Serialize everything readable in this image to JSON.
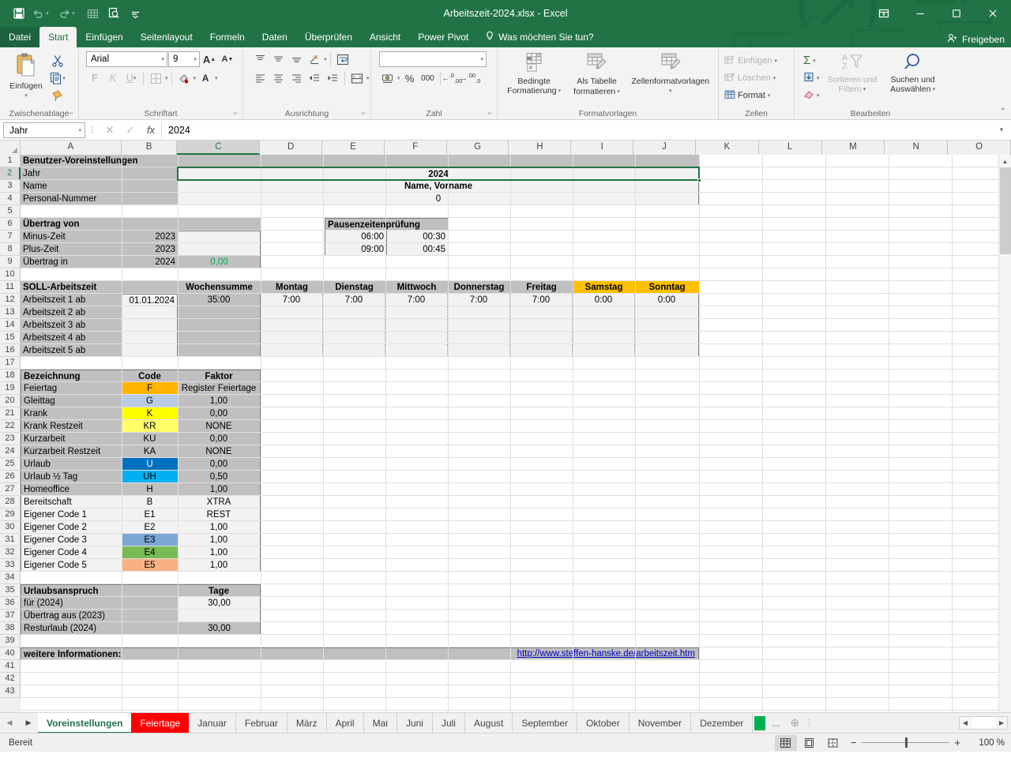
{
  "titlebar": {
    "title": "Arbeitszeit-2024.xlsx - Excel",
    "quick_access": [
      {
        "name": "save-icon",
        "label": "Speichern"
      },
      {
        "name": "undo-icon",
        "label": "Rückgängig"
      },
      {
        "name": "redo-icon",
        "label": "Wiederholen"
      },
      {
        "name": "table-icon",
        "label": "Tabelle"
      },
      {
        "name": "print-preview-icon",
        "label": "Seitenansicht"
      },
      {
        "name": "customize-qat-icon",
        "label": "Symbolleiste anpassen"
      }
    ],
    "window_buttons": {
      "ribbon_display": "Menüband-Anzeigeoptionen",
      "minimize": "Minimieren",
      "restore": "Wiederherstellen",
      "close": "Schließen"
    }
  },
  "ribbon": {
    "tabs": [
      {
        "label": "Datei",
        "active": false
      },
      {
        "label": "Start",
        "active": true
      },
      {
        "label": "Einfügen",
        "active": false
      },
      {
        "label": "Seitenlayout",
        "active": false
      },
      {
        "label": "Formeln",
        "active": false
      },
      {
        "label": "Daten",
        "active": false
      },
      {
        "label": "Überprüfen",
        "active": false
      },
      {
        "label": "Ansicht",
        "active": false
      },
      {
        "label": "Power Pivot",
        "active": false
      }
    ],
    "tellme": "Was möchten Sie tun?",
    "share": "Freigeben",
    "groups": {
      "clipboard": {
        "title": "Zwischenablage",
        "paste": "Einfügen",
        "cut": "Ausschneiden",
        "copy": "Kopieren",
        "format_painter": "Format übertragen"
      },
      "font": {
        "title": "Schriftart",
        "font_name": "Arial",
        "font_size": "9",
        "grow": "A",
        "shrink": "A",
        "bold": "F",
        "italic": "K",
        "underline": "U",
        "borders": "Rahmen",
        "fill": "Füllfarbe",
        "color": "A"
      },
      "alignment": {
        "title": "Ausrichtung",
        "wrap": "Zeilenumbruch",
        "merge": "Verbinden und zentrieren"
      },
      "number": {
        "title": "Zahl",
        "format_value": "",
        "currency": "Buchhaltungsformat",
        "percent": "%",
        "thousands": "000",
        "inc_dec": "Dezimalstelle hinzufügen",
        "dec_dec": "Dezimalstelle löschen"
      },
      "styles": {
        "title": "Formatvorlagen",
        "conditional": "Bedingte\nFormatierung",
        "conditional_l1": "Bedingte",
        "conditional_l2": "Formatierung",
        "as_table_l1": "Als Tabelle",
        "as_table_l2": "formatieren",
        "cell_styles": "Zellenformatvorlagen"
      },
      "cells": {
        "title": "Zellen",
        "insert": "Einfügen",
        "delete": "Löschen",
        "format": "Format"
      },
      "editing": {
        "title": "Bearbeiten",
        "autosum": "AutoSumme",
        "fill": "Füllbereich",
        "clear": "Löschen",
        "sort_l1": "Sortieren und",
        "sort_l2": "Filtern",
        "find_l1": "Suchen und",
        "find_l2": "Auswählen"
      }
    }
  },
  "formulabar": {
    "namebox": "Jahr",
    "cancel": "✕",
    "enter": "✓",
    "fx": "fx",
    "value": "2024"
  },
  "grid": {
    "columns": [
      "A",
      "B",
      "C",
      "D",
      "E",
      "F",
      "G",
      "H",
      "I",
      "J",
      "K",
      "L",
      "M",
      "N",
      "O"
    ],
    "selected_column": "C",
    "selected_row": 2,
    "rows": [
      1,
      2,
      3,
      4,
      5,
      6,
      7,
      8,
      9,
      10,
      11,
      12,
      13,
      14,
      15,
      16,
      17,
      18,
      19,
      20,
      21,
      22,
      23,
      24,
      25,
      26,
      27,
      28,
      29,
      30,
      31,
      32,
      33,
      34,
      35,
      36,
      37,
      38,
      39,
      40,
      41,
      42,
      43
    ],
    "sections": {
      "user_prefs": {
        "header": "Benutzer-Voreinstellungen",
        "rows": [
          {
            "label": "Jahr",
            "value": "2024"
          },
          {
            "label": "Name",
            "value": "Name, Vorname"
          },
          {
            "label": "Personal-Nummer",
            "value": "0"
          }
        ]
      },
      "carryover": {
        "header": "Übertrag von",
        "rows": [
          {
            "label": "Minus-Zeit",
            "year": "2023",
            "value": ""
          },
          {
            "label": "Plus-Zeit",
            "year": "2023",
            "value": ""
          },
          {
            "label": "Übertrag in",
            "year": "2024",
            "value": "0,00"
          }
        ]
      },
      "breaks": {
        "header": "Pausenzeitenprüfung",
        "rows": [
          {
            "from": "06:00",
            "pause": "00:30"
          },
          {
            "from": "09:00",
            "pause": "00:45"
          }
        ]
      },
      "target_hours": {
        "header": "SOLL-Arbeitszeit",
        "columns": [
          "Wochensumme",
          "Montag",
          "Dienstag",
          "Mittwoch",
          "Donnerstag",
          "Freitag",
          "Samstag",
          "Sonntag"
        ],
        "weekend_columns": [
          "Samstag",
          "Sonntag"
        ],
        "rows": [
          {
            "label": "Arbeitszeit 1 ab",
            "date": "01.01.2024",
            "week_sum": "35:00",
            "days": [
              "7:00",
              "7:00",
              "7:00",
              "7:00",
              "7:00",
              "0:00",
              "0:00"
            ]
          },
          {
            "label": "Arbeitszeit 2 ab",
            "date": "",
            "week_sum": "",
            "days": [
              "",
              "",
              "",
              "",
              "",
              "",
              ""
            ]
          },
          {
            "label": "Arbeitszeit 3 ab",
            "date": "",
            "week_sum": "",
            "days": [
              "",
              "",
              "",
              "",
              "",
              "",
              ""
            ]
          },
          {
            "label": "Arbeitszeit 4 ab",
            "date": "",
            "week_sum": "",
            "days": [
              "",
              "",
              "",
              "",
              "",
              "",
              ""
            ]
          },
          {
            "label": "Arbeitszeit 5 ab",
            "date": "",
            "week_sum": "",
            "days": [
              "",
              "",
              "",
              "",
              "",
              "",
              ""
            ]
          }
        ]
      },
      "codes": {
        "headers": [
          "Bezeichnung",
          "Code",
          "Faktor"
        ],
        "rows": [
          {
            "name": "Feiertag",
            "code": "F",
            "factor": "Register Feiertage",
            "code_bg": "#ffb400",
            "row_bg": "#c0c0c0"
          },
          {
            "name": "Gleittag",
            "code": "G",
            "factor": "1,00",
            "code_bg": "#b8cce4",
            "row_bg": "#c0c0c0"
          },
          {
            "name": "Krank",
            "code": "K",
            "factor": "0,00",
            "code_bg": "#ffff00",
            "row_bg": "#c0c0c0"
          },
          {
            "name": "Krank Restzeit",
            "code": "KR",
            "factor": "NONE",
            "code_bg": "#ffff66",
            "row_bg": "#c0c0c0"
          },
          {
            "name": "Kurzarbeit",
            "code": "KU",
            "factor": "0,00",
            "code_bg": "",
            "row_bg": "#c0c0c0"
          },
          {
            "name": "Kurzarbeit Restzeit",
            "code": "KA",
            "factor": "NONE",
            "code_bg": "",
            "row_bg": "#c0c0c0"
          },
          {
            "name": "Urlaub",
            "code": "U",
            "factor": "0,00",
            "code_bg": "#0070c0",
            "row_bg": "#c0c0c0"
          },
          {
            "name": "Urlaub ½ Tag",
            "code": "UH",
            "factor": "0,50",
            "code_bg": "#00b0f0",
            "row_bg": "#c0c0c0"
          },
          {
            "name": "Homeoffice",
            "code": "H",
            "factor": "1,00",
            "code_bg": "",
            "row_bg": "#c0c0c0"
          },
          {
            "name": "Bereitschaft",
            "code": "B",
            "factor": "XTRA",
            "code_bg": "",
            "row_bg": "#f2f2f2"
          },
          {
            "name": "Eigener Code 1",
            "code": "E1",
            "factor": "REST",
            "code_bg": "",
            "row_bg": "#f2f2f2"
          },
          {
            "name": "Eigener Code 2",
            "code": "E2",
            "factor": "1,00",
            "code_bg": "",
            "row_bg": "#f2f2f2"
          },
          {
            "name": "Eigener Code 3",
            "code": "E3",
            "factor": "1,00",
            "code_bg": "#7ba7d7",
            "row_bg": "#f2f2f2"
          },
          {
            "name": "Eigener Code 4",
            "code": "E4",
            "factor": "1,00",
            "code_bg": "#77bb55",
            "row_bg": "#f2f2f2"
          },
          {
            "name": "Eigener Code 5",
            "code": "E5",
            "factor": "1,00",
            "code_bg": "#f9b183",
            "row_bg": "#f2f2f2"
          }
        ]
      },
      "vacation": {
        "header": "Urlaubsanspruch",
        "unit": "Tage",
        "rows": [
          {
            "label": "für (2024)",
            "value": "30,00"
          },
          {
            "label": "Übertrag aus (2023)",
            "value": ""
          },
          {
            "label": "Resturlaub (2024)",
            "value": "30,00"
          }
        ]
      },
      "more_info": {
        "label": "weitere Informationen:",
        "link": "http://www.steffen-hanske.de/arbeitszeit.htm"
      }
    }
  },
  "sheettabs": {
    "nav_prev": "◀",
    "nav_next": "▶",
    "tabs": [
      {
        "label": "Voreinstellungen",
        "style": "active"
      },
      {
        "label": "Feiertage",
        "style": "red"
      },
      {
        "label": "Januar",
        "style": "normal"
      },
      {
        "label": "Februar",
        "style": "normal"
      },
      {
        "label": "März",
        "style": "normal"
      },
      {
        "label": "April",
        "style": "normal"
      },
      {
        "label": "Mai",
        "style": "normal"
      },
      {
        "label": "Juni",
        "style": "normal"
      },
      {
        "label": "Juli",
        "style": "normal"
      },
      {
        "label": "August",
        "style": "normal"
      },
      {
        "label": "September",
        "style": "normal"
      },
      {
        "label": "Oktober",
        "style": "normal"
      },
      {
        "label": "November",
        "style": "normal"
      },
      {
        "label": "Dezember",
        "style": "normal"
      }
    ],
    "green_chip": "",
    "overflow": "...",
    "add_sheet": "+"
  },
  "statusbar": {
    "status": "Bereit",
    "views": [
      "normal-view",
      "page-layout-view",
      "page-break-view"
    ],
    "active_view": "normal-view",
    "zoom_out": "−",
    "zoom_in": "+",
    "zoom_level": "100 %"
  },
  "colors": {
    "excel_green": "#217346",
    "header_gray": "#c0c0c0",
    "light_gray": "#f2f2f2",
    "weekend_orange": "#ffc000",
    "link_blue": "#0000c0",
    "carry_green": "#00b050",
    "tab_red": "#ff0000"
  }
}
